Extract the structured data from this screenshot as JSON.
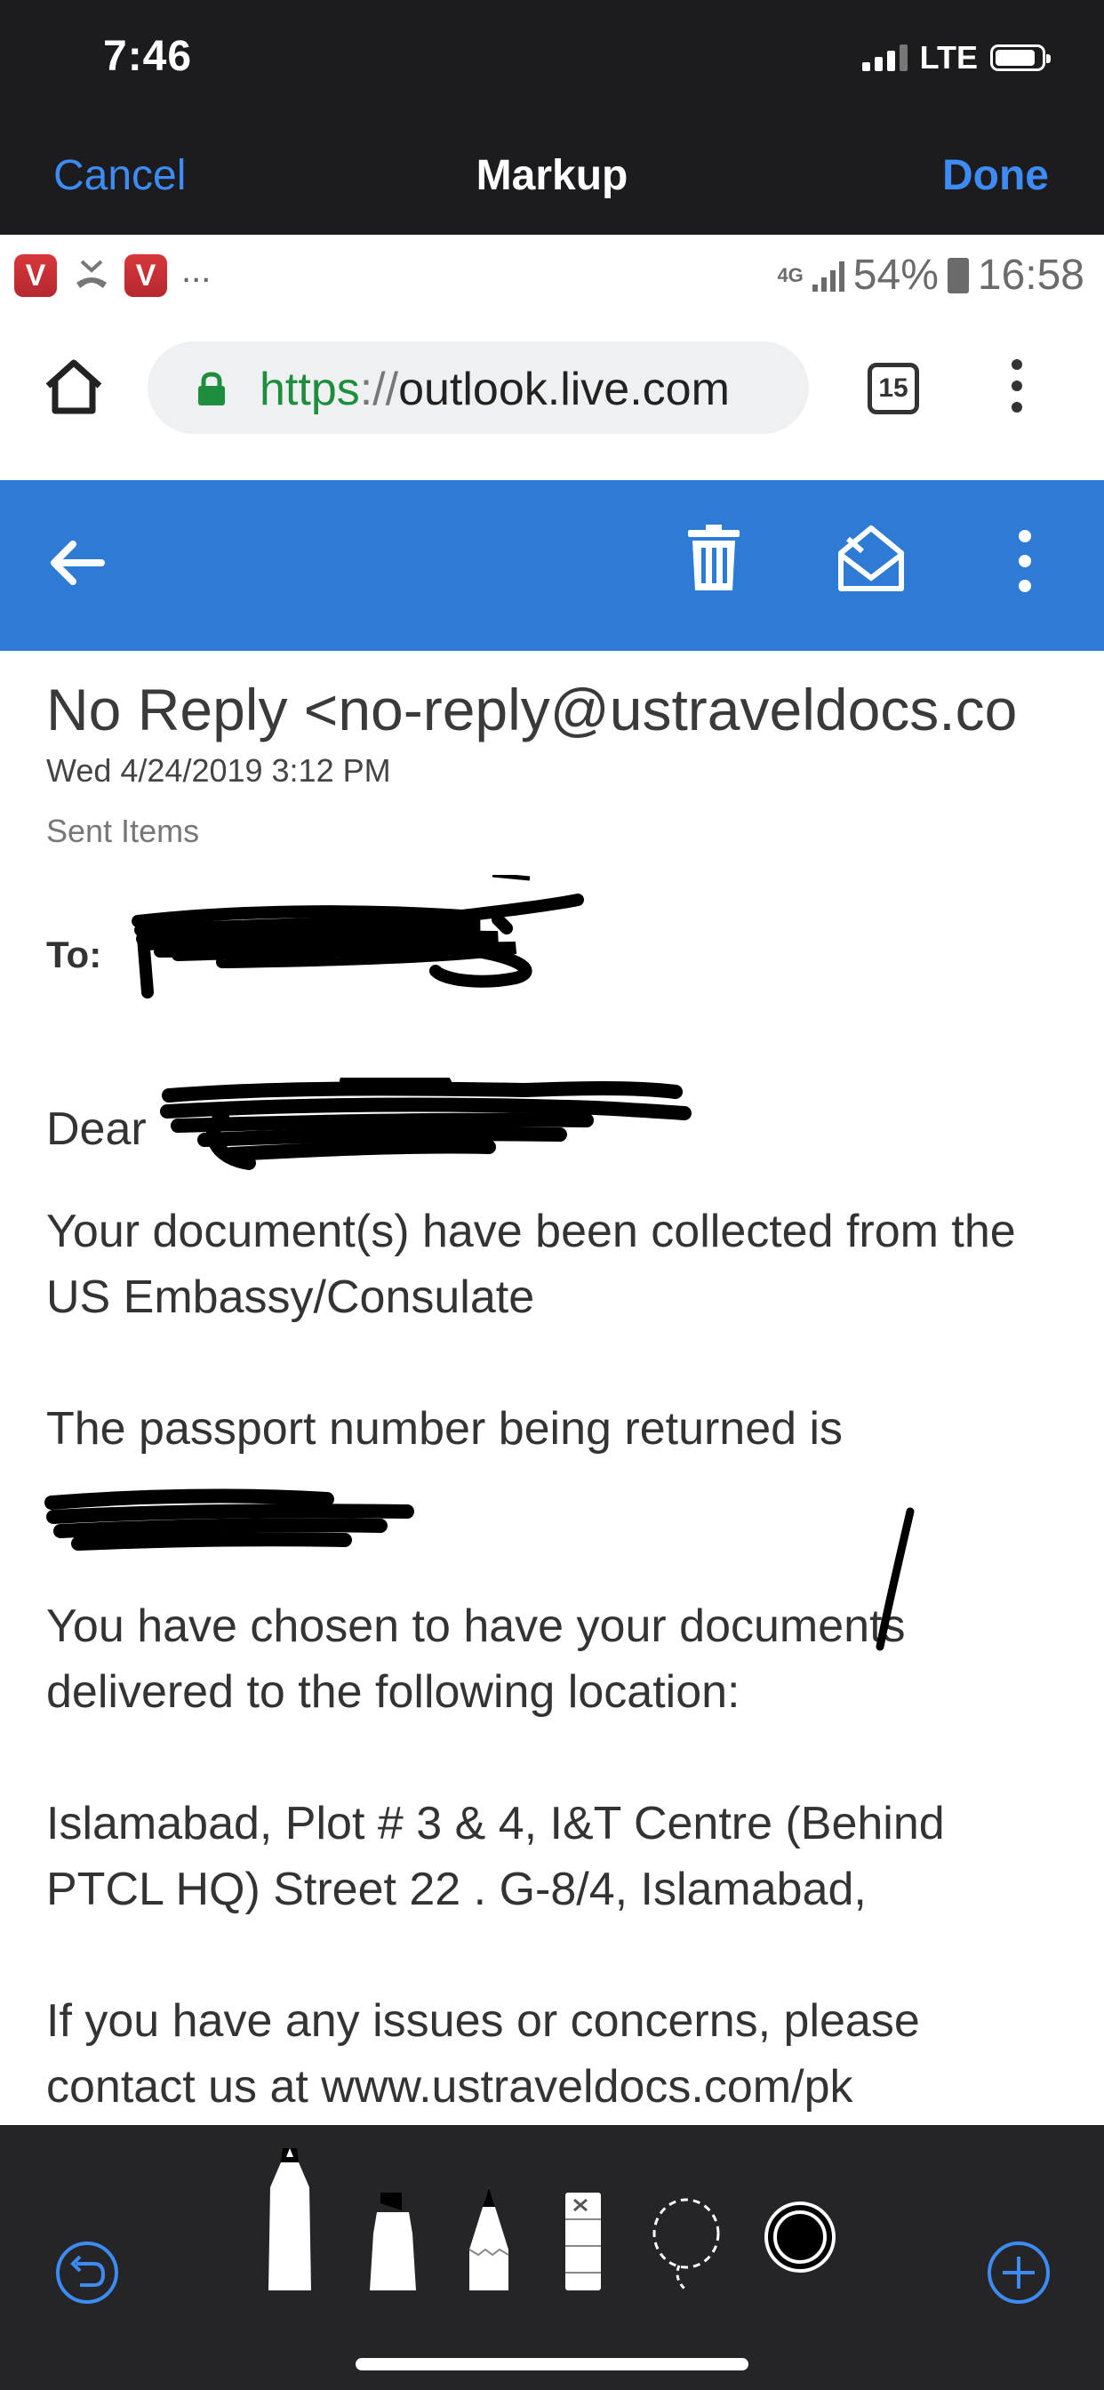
{
  "ios_status": {
    "time": "7:46",
    "network": "LTE"
  },
  "markup_nav": {
    "cancel_label": "Cancel",
    "title": "Markup",
    "done_label": "Done"
  },
  "android_status": {
    "app_icon_letter": "V",
    "more_indicator": "...",
    "network": "4G",
    "battery_percent": "54%",
    "time": "16:58"
  },
  "browser": {
    "url_scheme": "https",
    "url_separator": "://",
    "url_host": "outlook.live.com",
    "tab_count": "15"
  },
  "email": {
    "sender": "No Reply <no-reply@ustraveldocs.co",
    "sent_date": "Wed 4/24/2019 3:12 PM",
    "folder": "Sent Items",
    "to_label": "To:",
    "salutation": "Dear",
    "paragraphs": [
      "Your document(s) have been collected from the US Embassy/Consulate",
      "The passport number being returned is",
      "You have chosen to have your documents delivered to the following location:",
      "Islamabad, Plot # 3 & 4, I&T Centre (Behind PTCL HQ) Street 22 . G-8/4, Islamabad,",
      "If you have any issues or concerns, please contact us at www.ustraveldocs.com/pk"
    ]
  },
  "icons": {
    "ios_status": [
      "signal-bars-icon",
      "battery-icon"
    ],
    "android_status": [
      "app-v-icon",
      "missed-call-icon",
      "signal-icon",
      "battery-icon"
    ],
    "browser": [
      "home-icon",
      "lock-icon",
      "tabs-icon",
      "overflow-menu-icon"
    ],
    "outlook_toolbar": [
      "back-arrow-icon",
      "trash-icon",
      "mark-read-icon",
      "more-icon"
    ],
    "markup_tools": [
      "undo-icon",
      "pen-icon",
      "highlighter-icon",
      "pencil-icon",
      "eraser-icon",
      "lasso-icon",
      "color-picker-icon",
      "add-icon"
    ]
  },
  "colors": {
    "accent": "#3d8cf5",
    "outlook_blue": "#2e7bd6",
    "https_green": "#1e8e3e",
    "toolbar_bg": "#252527",
    "redaction": "#000000"
  }
}
